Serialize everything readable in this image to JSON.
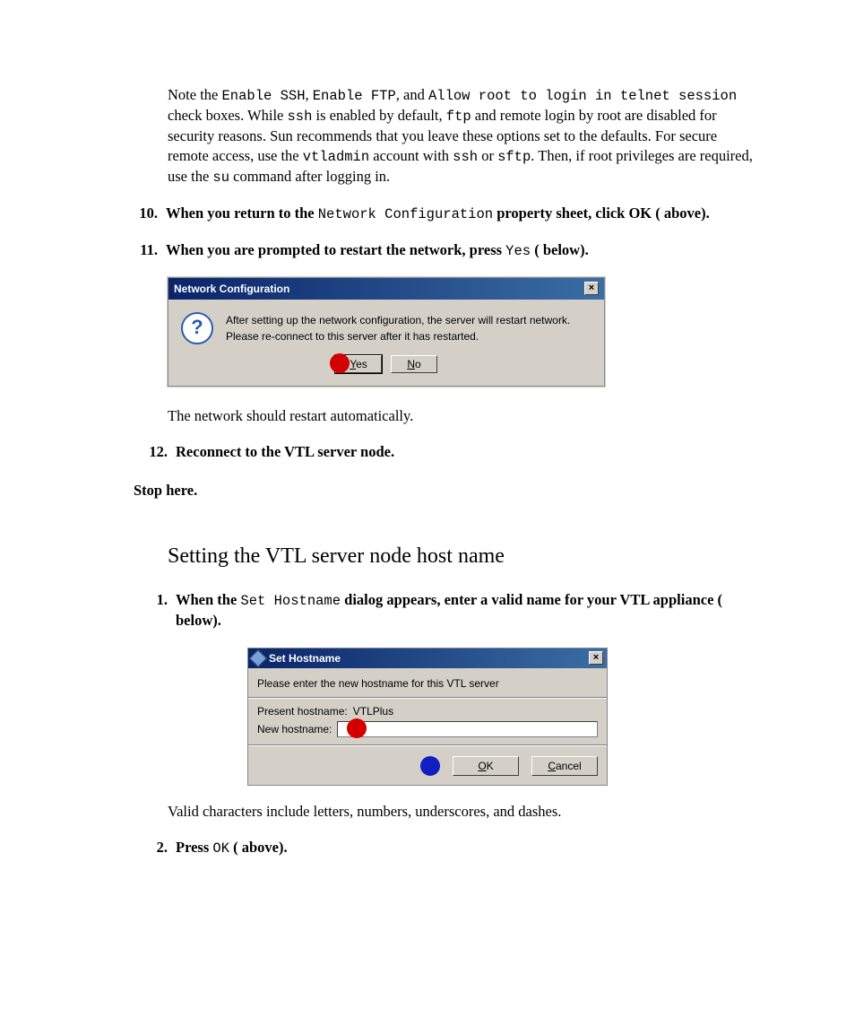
{
  "intro": {
    "pre1": "Note the ",
    "code1": "Enable SSH",
    "mid1": ", ",
    "code2": "Enable FTP",
    "mid2": ", and ",
    "code3": "Allow root to login in telnet session",
    "post1": " check boxes. While ",
    "code4": "ssh",
    "post2": " is enabled by default, ",
    "code5": "ftp",
    "post3": " and remote  login by root are disabled for security reasons. Sun recommends that you leave these options set to the defaults. For secure remote access, use the ",
    "code6": "vtladmin",
    "post4": " account with ",
    "code7": "ssh",
    "post5": " or ",
    "code8": "sftp",
    "post6": ". Then, if root privileges are required, use the ",
    "code9": "su",
    "post7": " command after logging in."
  },
  "step10": {
    "num": "10.",
    "a": "When you return to the ",
    "code": "Network Configuration",
    "b": " property sheet, click OK (   above)."
  },
  "step11": {
    "num": "11.",
    "a": "When you are prompted to restart the network, press ",
    "code": "Yes",
    "b": " (   below)."
  },
  "dialog1": {
    "title": "Network Configuration",
    "line1": "After setting up the network configuration, the server will restart network.",
    "line2": "Please re-connect to this server after it has restarted.",
    "yes": "Yes",
    "no": "No"
  },
  "after_dlg1": "The network should restart automatically.",
  "step12": {
    "num": "12.",
    "text": "Reconnect to the VTL server node."
  },
  "stop_here": "Stop here.",
  "section_title": "Setting the VTL server node host name",
  "sec2_step1": {
    "num": "1.",
    "a": "When the ",
    "code": "Set Hostname",
    "b": " dialog appears, enter a valid name for your VTL appliance (   below)."
  },
  "dialog2": {
    "title": "Set Hostname",
    "instr": "Please enter the new hostname for this VTL server",
    "present_label": "Present hostname:",
    "present_value": "VTLPlus",
    "new_label": "New hostname:",
    "ok": "OK",
    "cancel": "Cancel"
  },
  "after_dlg2": "Valid characters include letters, numbers, underscores, and dashes.",
  "sec2_step2": {
    "num": "2.",
    "a": "Press ",
    "code": "OK",
    "b": " (   above)."
  }
}
